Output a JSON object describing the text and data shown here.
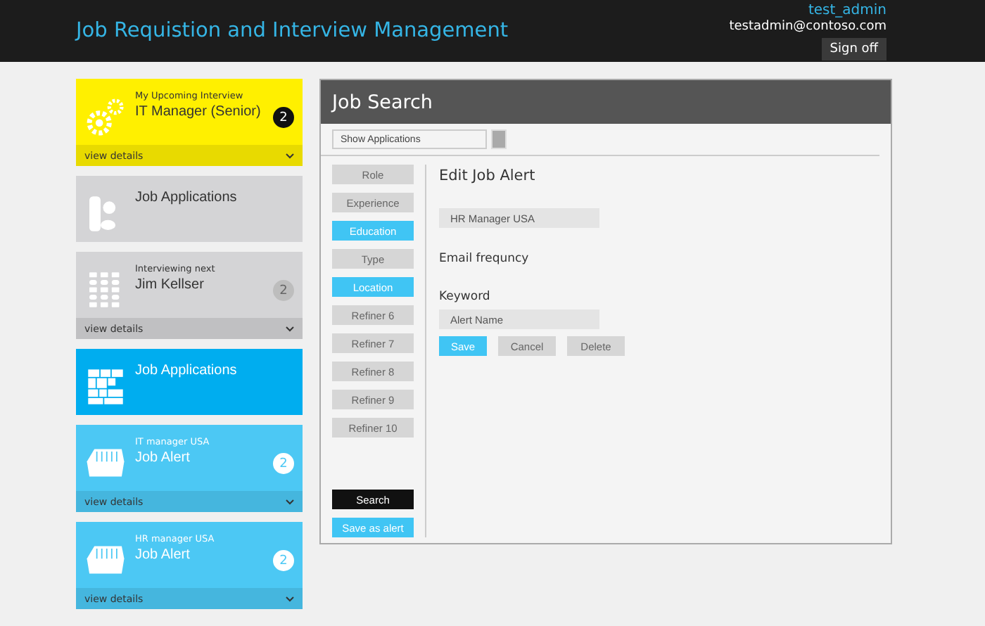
{
  "header": {
    "title": "Job Requistion and Interview Management",
    "user": "test_admin",
    "email": "testadmin@contoso.com",
    "sign_off": "Sign off"
  },
  "tiles": [
    {
      "kind": "detail",
      "color": "#fff000",
      "caption": "My Upcoming Interview",
      "title": "IT Manager (Senior)",
      "count": "2",
      "footer": "view details"
    },
    {
      "kind": "link",
      "color": "#d4d4d6",
      "title": "Job Applications"
    },
    {
      "kind": "detail",
      "color": "#d4d4d6",
      "caption": "Interviewing next",
      "title": "Jim Kellser",
      "count": "2",
      "footer": "view details"
    },
    {
      "kind": "link",
      "color": "#00adef",
      "title": "Job Applications"
    },
    {
      "kind": "detail",
      "color": "#4cc8f4",
      "caption": "IT manager USA",
      "title": "Job Alert",
      "count": "2",
      "footer": "view details"
    },
    {
      "kind": "detail",
      "color": "#4cc8f4",
      "caption": "HR manager USA",
      "title": "Job Alert",
      "count": "2",
      "footer": "view details"
    }
  ],
  "panel": {
    "title": "Job Search",
    "dropdown": "Show Applications",
    "refiners": [
      {
        "label": "Role",
        "selected": false
      },
      {
        "label": "Experience",
        "selected": false
      },
      {
        "label": "Education",
        "selected": true
      },
      {
        "label": "Type",
        "selected": false
      },
      {
        "label": "Location",
        "selected": true
      },
      {
        "label": "Refiner 6",
        "selected": false
      },
      {
        "label": "Refiner 7",
        "selected": false
      },
      {
        "label": "Refiner 8",
        "selected": false
      },
      {
        "label": "Refiner 9",
        "selected": false
      },
      {
        "label": "Refiner 10",
        "selected": false
      }
    ],
    "search_button": "Search",
    "save_alert_button": "Save as alert",
    "form": {
      "heading": "Edit Job Alert",
      "name_value": "HR Manager USA",
      "email_label": "Email frequncy",
      "keyword_label": "Keyword",
      "keyword_placeholder": "Alert Name",
      "buttons": [
        {
          "label": "Save",
          "kind": "primary"
        },
        {
          "label": "Cancel",
          "kind": "secondary"
        },
        {
          "label": "Delete",
          "kind": "secondary"
        }
      ]
    }
  }
}
